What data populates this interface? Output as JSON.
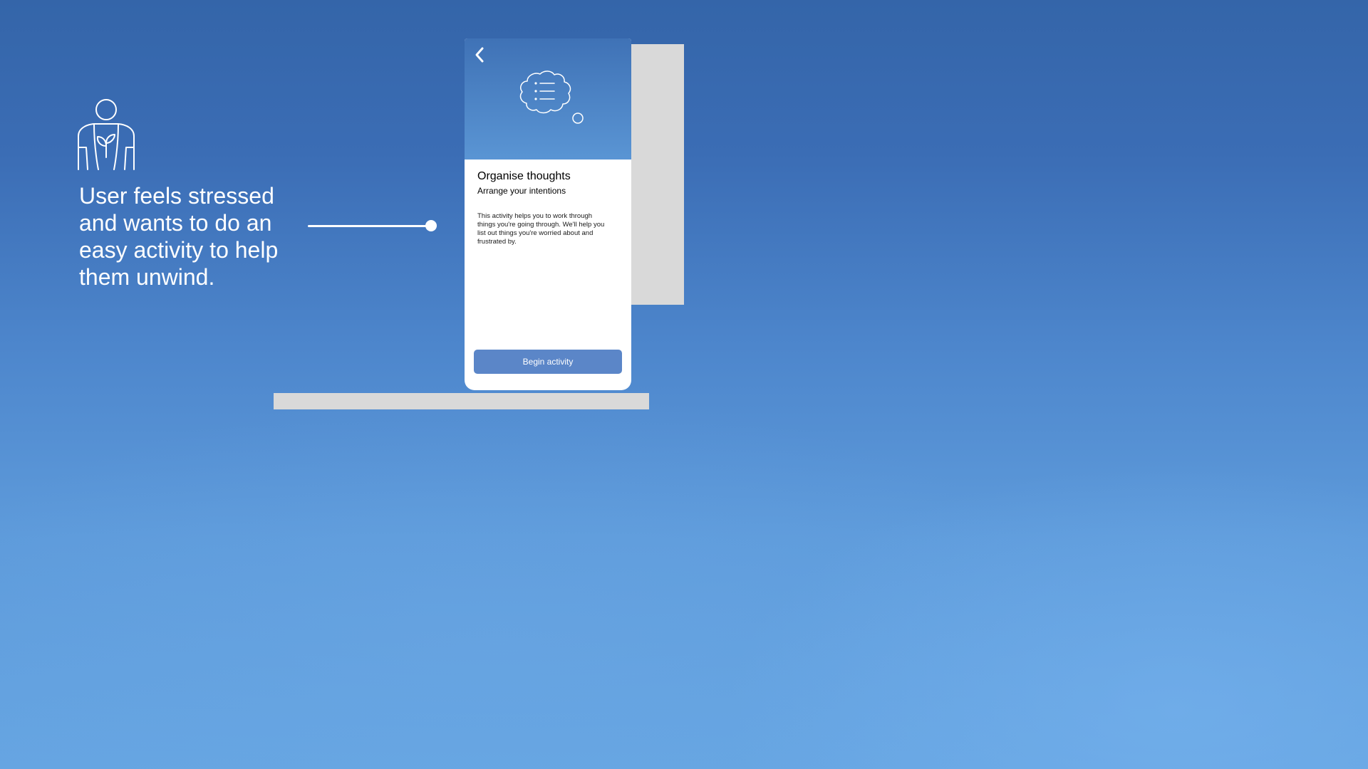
{
  "persona": {
    "icon": "person-with-plant-icon",
    "text": "User feels stressed and wants to do an easy activity to help them unwind."
  },
  "connector": {
    "icon": "connector-dot"
  },
  "phone": {
    "back_icon": "chevron-left-icon",
    "hero_icon": "thought-bubble-list-icon",
    "title": "Organise thoughts",
    "subtitle": "Arrange your intentions",
    "body": "This activity helps you to work through things you're going through. We'll help you list out things you're worried about and frustrated by.",
    "button_label": "Begin activity"
  },
  "colors": {
    "background_top": "#3465a9",
    "background_bottom": "#66a5e2",
    "button": "#5b86c8",
    "placeholder_grey": "#d9d9d9"
  }
}
